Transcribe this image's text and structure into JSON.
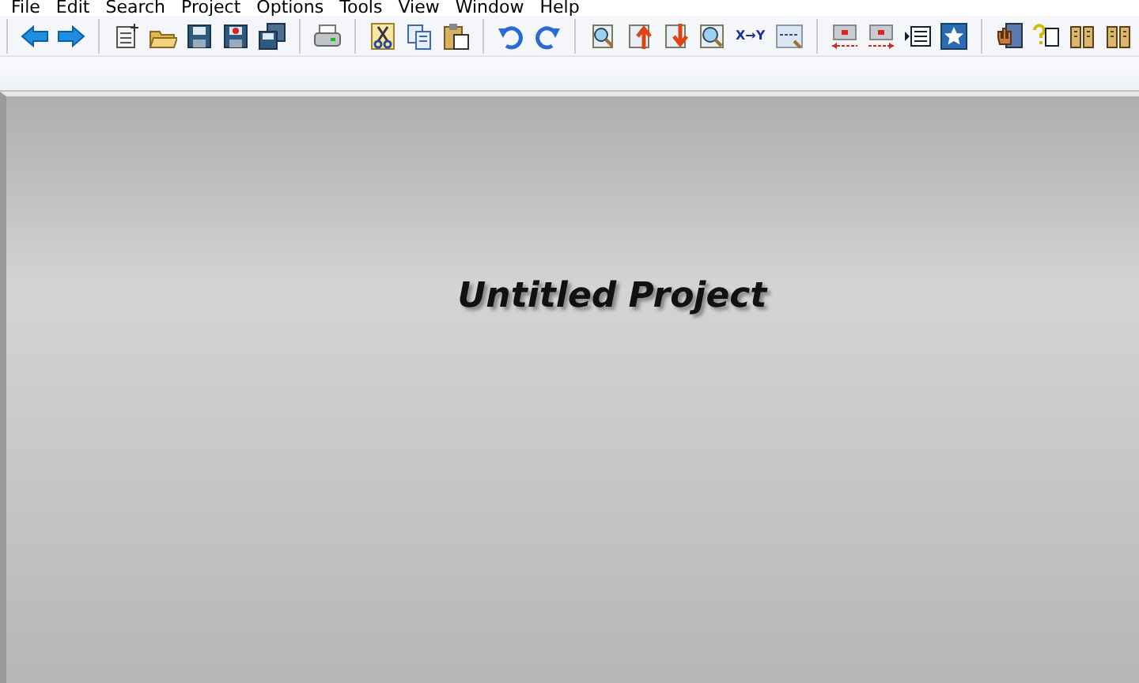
{
  "menu": [
    "File",
    "Edit",
    "Search",
    "Project",
    "Options",
    "Tools",
    "View",
    "Window",
    "Help"
  ],
  "toolbar": [
    [
      {
        "kind": "back"
      },
      {
        "kind": "forward"
      }
    ],
    [
      {
        "kind": "new"
      },
      {
        "kind": "open"
      },
      {
        "kind": "save"
      },
      {
        "kind": "saveas"
      },
      {
        "kind": "saveall"
      }
    ],
    [
      {
        "kind": "print"
      }
    ],
    [
      {
        "kind": "cut"
      },
      {
        "kind": "copy"
      },
      {
        "kind": "paste"
      }
    ],
    [
      {
        "kind": "undo"
      },
      {
        "kind": "redo"
      }
    ],
    [
      {
        "kind": "find"
      },
      {
        "kind": "up"
      },
      {
        "kind": "down"
      },
      {
        "kind": "zoom"
      },
      {
        "kind": "text",
        "label": "X→Y"
      },
      {
        "kind": "web"
      }
    ],
    [
      {
        "kind": "splitleft"
      },
      {
        "kind": "splitright"
      },
      {
        "kind": "list"
      },
      {
        "kind": "star"
      }
    ],
    [
      {
        "kind": "hand"
      },
      {
        "kind": "help"
      },
      {
        "kind": "book"
      },
      {
        "kind": "book"
      }
    ]
  ],
  "project_title": "Untitled Project"
}
